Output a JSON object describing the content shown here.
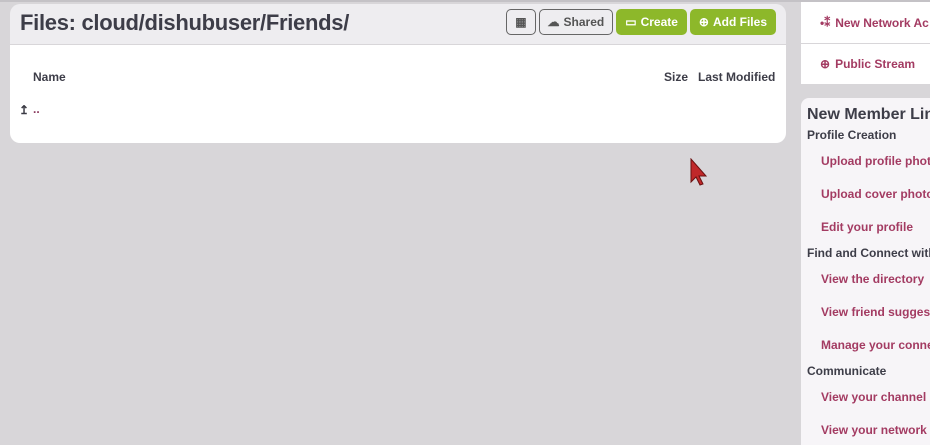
{
  "header": {
    "title": "Files: cloud/dishubuser/Friends/",
    "buttons": {
      "grid_icon": "table-icon",
      "shared": "Shared",
      "create": "Create",
      "add_files": "Add Files"
    }
  },
  "table": {
    "columns": {
      "name": "Name",
      "size": "Size",
      "modified": "Last Modified"
    },
    "rows": [
      {
        "icon": "level-up-icon",
        "name": ".."
      }
    ]
  },
  "sidebar": {
    "links": [
      {
        "icon": "network-icon",
        "label": "New Network Ac"
      },
      {
        "icon": "globe-icon",
        "label": "Public Stream"
      }
    ]
  },
  "new_member": {
    "title": "New Member Lin",
    "sections": [
      {
        "label": "Profile Creation",
        "links": [
          "Upload profile photo",
          "Upload cover photo",
          "Edit your profile"
        ]
      },
      {
        "label": "Find and Connect with",
        "links": [
          "View the directory",
          "View friend suggest",
          "Manage your conne"
        ]
      },
      {
        "label": "Communicate",
        "links": [
          "View your channel h",
          "View your network s"
        ]
      }
    ]
  },
  "colors": {
    "accent": "#8db82a",
    "link": "#a33b62",
    "background": "#d8d6d9"
  }
}
